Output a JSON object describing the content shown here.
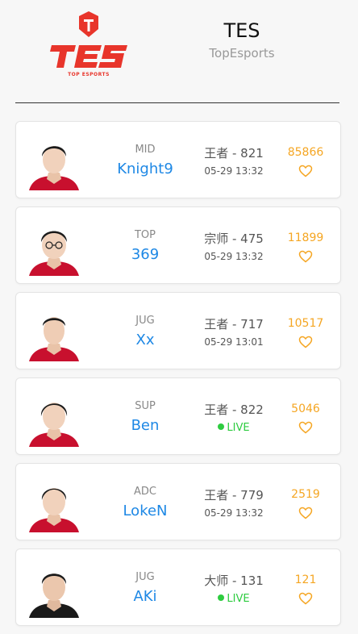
{
  "team": {
    "name": "TES",
    "full_name": "TopEsports",
    "logo_text": "TES",
    "logo_subtext": "TOP ESPORTS"
  },
  "colors": {
    "player_name": "#1e88e5",
    "likes": "#f5a623",
    "live": "#2ecc40",
    "logo": "#e8352b"
  },
  "players": [
    {
      "role": "MID",
      "name": "Knight9",
      "rank": "王者 - 821",
      "status": "05-29 13:32",
      "live": false,
      "likes": "85866",
      "icon": "heart-icon"
    },
    {
      "role": "TOP",
      "name": "369",
      "rank": "宗师 - 475",
      "status": "05-29 13:32",
      "live": false,
      "likes": "11899",
      "icon": "heart-icon"
    },
    {
      "role": "JUG",
      "name": "Xx",
      "rank": "王者 - 717",
      "status": "05-29 13:01",
      "live": false,
      "likes": "10517",
      "icon": "heart-icon"
    },
    {
      "role": "SUP",
      "name": "Ben",
      "rank": "王者 - 822",
      "status": "LIVE",
      "live": true,
      "likes": "5046",
      "icon": "heart-icon"
    },
    {
      "role": "ADC",
      "name": "LokeN",
      "rank": "王者 - 779",
      "status": "05-29 13:32",
      "live": false,
      "likes": "2519",
      "icon": "heart-icon"
    },
    {
      "role": "JUG",
      "name": "AKi",
      "rank": "大师 - 131",
      "status": "LIVE",
      "live": true,
      "likes": "121",
      "icon": "heart-icon"
    }
  ]
}
